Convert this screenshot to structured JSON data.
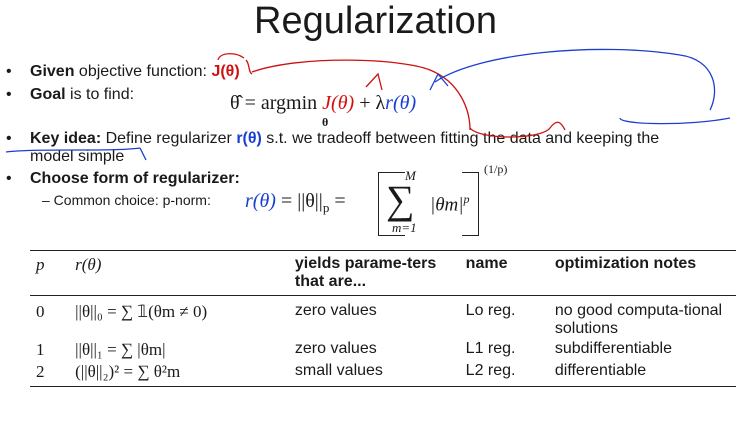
{
  "title": "Regularization",
  "bullets": {
    "given_bold": "Given",
    "given_text": " objective function: ",
    "given_fn": "J(θ)",
    "goal_bold": "Goal",
    "goal_text": " is to find:",
    "goal_eq_lhs": "θ̂ = argmin",
    "goal_eq_sub": "θ",
    "goal_eq_J": "J(θ)",
    "goal_eq_plus": " + λ",
    "goal_eq_r": "r(θ)",
    "key_bold": "Key idea:",
    "key_text": " Define regularizer ",
    "key_r": "r(θ)",
    "key_text2": " s.t. we tradeoff between fitting the data and keeping the",
    "key_text3": "model simple",
    "choose_bold": "Choose form of regularizer:",
    "common_label": "– Common choice: p-norm:",
    "pnorm_lhs": "r(θ)",
    "pnorm_eq": " = ||θ||",
    "pnorm_p": "p",
    "pnorm_eq2": " = ",
    "pnorm_sum_top": "M",
    "pnorm_sum_bot": "m=1",
    "pnorm_body": "|θm|",
    "pnorm_exp": "(1/p)"
  },
  "table": {
    "headers": [
      "p",
      "r(θ)",
      "yields parame-ters that are...",
      "name",
      "optimization notes"
    ],
    "rows": [
      [
        "0",
        "||θ||₀ = ∑ 𝟙(θm ≠ 0)",
        "zero values",
        "Lo reg.",
        "no good computa-tional solutions"
      ],
      [
        "1",
        "||θ||₁ = ∑ |θm|",
        "zero values",
        "L1 reg.",
        "subdifferentiable"
      ],
      [
        "2",
        "(||θ||₂)² = ∑ θ²m",
        "small values",
        "L2 reg.",
        "differentiable"
      ]
    ]
  },
  "colors": {
    "red": "#d01010",
    "blue": "#1a3fd0"
  }
}
